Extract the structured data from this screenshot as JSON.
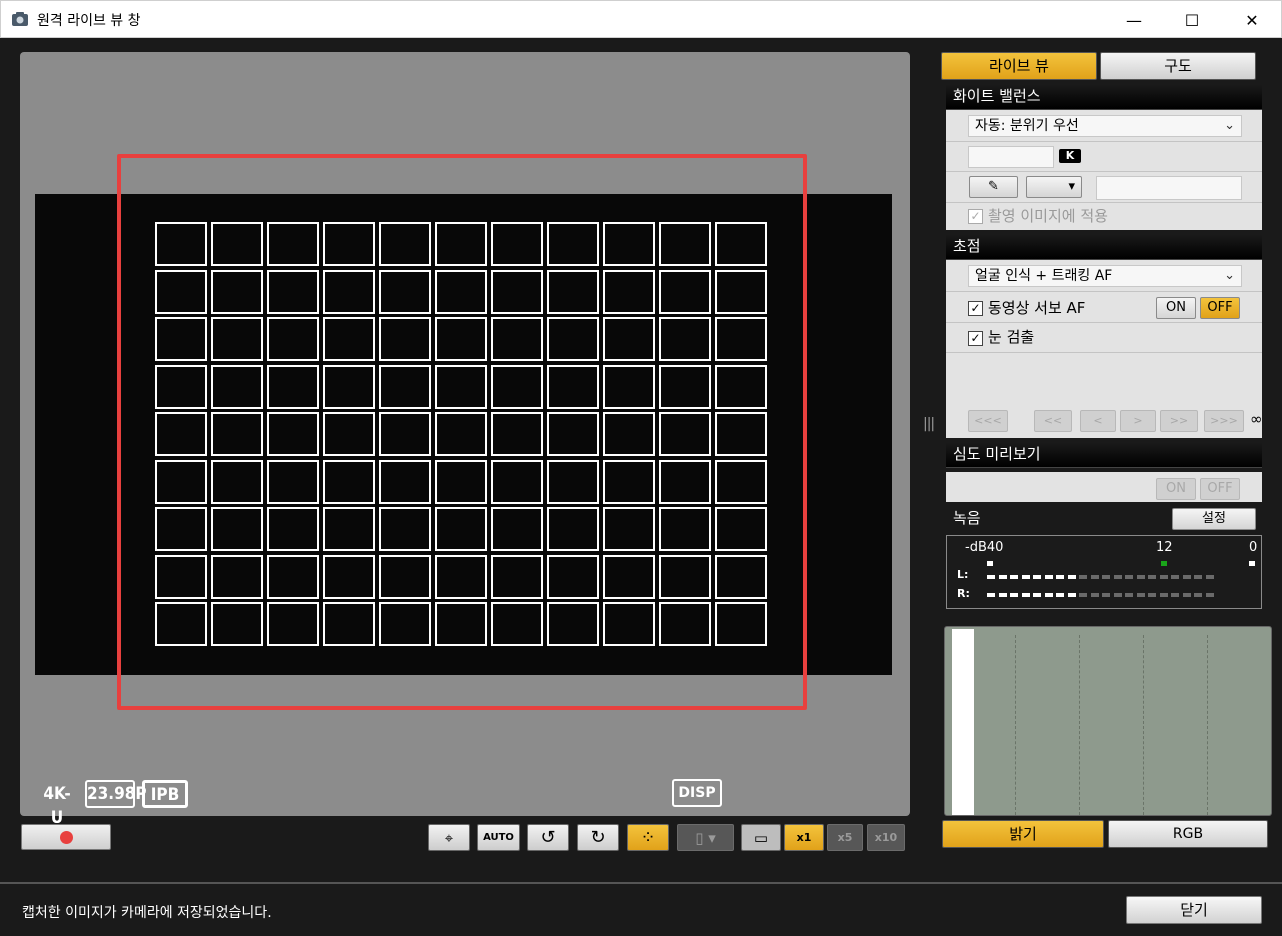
{
  "window": {
    "title": "원격 라이브 뷰 창",
    "minimize": "—",
    "maximize": "☐",
    "close": "✕"
  },
  "liveview": {
    "badges": {
      "resolution": "4K-U",
      "framerate": "23.98P",
      "compression": "IPB"
    },
    "disp_label": "DISP",
    "af_grid": {
      "columns": 11,
      "rows": 9
    }
  },
  "toolbar": {
    "record_indicator": "●",
    "af_frame_icon": "⌖",
    "auto_label": "AUTO",
    "rotate_left": "↺",
    "rotate_right": "↻",
    "grid_icon": "⁘",
    "aspect_icon": "▯ ▾",
    "frame_icon": "▭",
    "zoom_x1": "x1",
    "zoom_x5": "x5",
    "zoom_x10": "x10"
  },
  "right_panel": {
    "tabs": {
      "live": "라이브 뷰",
      "composition": "구도"
    },
    "white_balance": {
      "header": "화이트 밸런스",
      "mode": "자동: 분위기 우선",
      "kelvin_unit": "K",
      "eyedropper_icon": "✎",
      "dropdown_arrow": "▾",
      "apply_label": "촬영 이미지에 적용"
    },
    "focus": {
      "header": "초점",
      "mode": "얼굴 인식 + 트래킹 AF",
      "servo_label": "동영상 서보 AF",
      "servo_on": "ON",
      "servo_off": "OFF",
      "eye_detect_label": "눈 검출",
      "nav": [
        "<<<",
        "<<",
        "<",
        ">",
        ">>",
        ">>>"
      ],
      "infinity": "∞"
    },
    "dof": {
      "header": "심도 미리보기",
      "on": "ON",
      "off": "OFF"
    },
    "audio": {
      "header": "녹음",
      "settings_label": "설정",
      "scale_left": "-dB40",
      "scale_mid": "12",
      "scale_right": "0",
      "left_channel": "L:",
      "right_channel": "R:",
      "left_level_segments": 8,
      "right_level_segments": 8,
      "total_segments": 20
    },
    "histogram_tabs": {
      "brightness": "밝기",
      "rgb": "RGB"
    }
  },
  "status": {
    "message": "캡처한 이미지가 카메라에 저장되었습니다.",
    "close_label": "닫기"
  },
  "colors": {
    "accent": "#e8a82a",
    "frame_red": "#e8403e",
    "background": "#1a1a1a"
  }
}
